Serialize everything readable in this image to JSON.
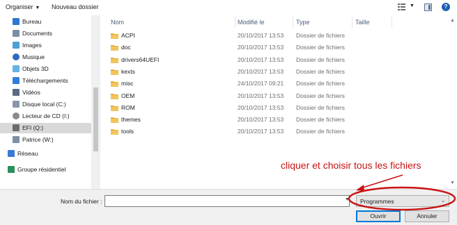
{
  "toolbar": {
    "organize_label": "Organiser",
    "new_folder_label": "Nouveau dossier",
    "help_glyph": "?"
  },
  "nav": {
    "items": [
      {
        "label": "Bureau",
        "icon": "desktop-icon"
      },
      {
        "label": "Documents",
        "icon": "documents-icon"
      },
      {
        "label": "Images",
        "icon": "pictures-icon"
      },
      {
        "label": "Musique",
        "icon": "music-icon"
      },
      {
        "label": "Objets 3D",
        "icon": "cube-icon"
      },
      {
        "label": "Téléchargements",
        "icon": "download-icon"
      },
      {
        "label": "Vidéos",
        "icon": "video-icon"
      },
      {
        "label": "Disque local (C:)",
        "icon": "drive-icon"
      },
      {
        "label": "Lecteur de CD (I:)",
        "icon": "cd-drive-icon"
      },
      {
        "label": "EFI (Q:)",
        "icon": "usb-drive-icon",
        "selected": true
      },
      {
        "label": "Patrice (W:)",
        "icon": "network-drive-icon"
      },
      {
        "label": "Réseau",
        "icon": "network-icon"
      },
      {
        "label": "Groupe résidentiel",
        "icon": "homegroup-icon"
      }
    ]
  },
  "columns": {
    "name": "Nom",
    "modified": "Modifié le",
    "type": "Type",
    "size": "Taille"
  },
  "files": [
    {
      "name": "ACPI",
      "modified": "20/10/2017 13:53",
      "type": "Dossier de fichiers",
      "size": ""
    },
    {
      "name": "doc",
      "modified": "20/10/2017 13:53",
      "type": "Dossier de fichiers",
      "size": ""
    },
    {
      "name": "drivers64UEFI",
      "modified": "20/10/2017 13:53",
      "type": "Dossier de fichiers",
      "size": ""
    },
    {
      "name": "kexts",
      "modified": "20/10/2017 13:53",
      "type": "Dossier de fichiers",
      "size": ""
    },
    {
      "name": "misc",
      "modified": "24/10/2017 09:21",
      "type": "Dossier de fichiers",
      "size": ""
    },
    {
      "name": "OEM",
      "modified": "20/10/2017 13:53",
      "type": "Dossier de fichiers",
      "size": ""
    },
    {
      "name": "ROM",
      "modified": "20/10/2017 13:53",
      "type": "Dossier de fichiers",
      "size": ""
    },
    {
      "name": "themes",
      "modified": "20/10/2017 13:53",
      "type": "Dossier de fichiers",
      "size": ""
    },
    {
      "name": "tools",
      "modified": "20/10/2017 13:53",
      "type": "Dossier de fichiers",
      "size": ""
    }
  ],
  "annotation": {
    "text": "cliquer et choisir tous les fichiers",
    "color": "#c81212"
  },
  "bottom": {
    "filename_label": "Nom du fichier :",
    "filename_value": "",
    "filter_value": "Programmes",
    "open_label": "Ouvrir",
    "cancel_label": "Annuler"
  },
  "colors": {
    "folder": "#f2c55c",
    "selection": "#d9d9d9",
    "accent": "#0078d7"
  }
}
